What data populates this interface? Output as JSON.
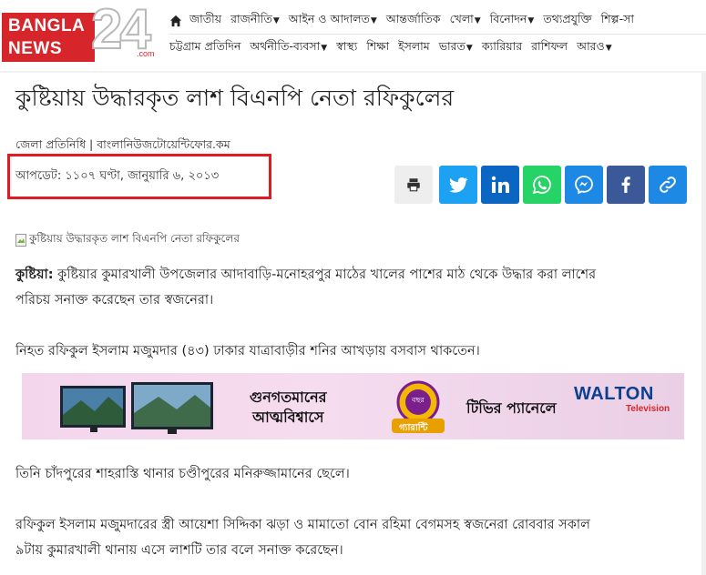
{
  "logo": {
    "line1": "BANGLA",
    "line2": "NEWS",
    "number": "24",
    "suffix": ".com"
  },
  "nav": {
    "row1": [
      {
        "label": "জাতীয়",
        "dropdown": false
      },
      {
        "label": "রাজনীতি",
        "dropdown": true
      },
      {
        "label": "আইন ও আদালত",
        "dropdown": true
      },
      {
        "label": "আন্তর্জাতিক",
        "dropdown": false
      },
      {
        "label": "খেলা",
        "dropdown": true
      },
      {
        "label": "বিনোদন",
        "dropdown": true
      },
      {
        "label": "তথ্যপ্রযুক্তি",
        "dropdown": false
      },
      {
        "label": "শিল্প-সা",
        "dropdown": false
      }
    ],
    "row2": [
      {
        "label": "চট্টগ্রাম প্রতিদিন",
        "dropdown": false
      },
      {
        "label": "অর্থনীতি-ব্যবসা",
        "dropdown": true
      },
      {
        "label": "স্বাস্থ্য",
        "dropdown": false
      },
      {
        "label": "শিক্ষা",
        "dropdown": false
      },
      {
        "label": "ইসলাম",
        "dropdown": false
      },
      {
        "label": "ভারত",
        "dropdown": true
      },
      {
        "label": "ক্যারিয়ার",
        "dropdown": false
      },
      {
        "label": "রাশিফল",
        "dropdown": false
      },
      {
        "label": "আরও",
        "dropdown": true
      }
    ]
  },
  "article": {
    "title": "কুষ্টিয়ায় উদ্ধারকৃত লাশ বিএনপি নেতা রফিকুলের",
    "byline": "জেলা প্রতিনিধি | বাংলানিউজটোয়েন্টিফোর.কম",
    "update": "আপডেট: ১১০৭ ঘণ্টা, জানুয়ারি ৬, ২০১৩",
    "image_alt": "কুষ্টিয়ায় উদ্ধারকৃত লাশ বিএনপি নেতা রফিকুলের",
    "dateline": "কুষ্টিয়া:",
    "p1_line1": " কুষ্টিয়ার কুমারখালী উপজেলার আদাবাড়ি-মনোহরপুর মাঠের খালের পাশের মাঠ থেকে উদ্ধার করা লাশের",
    "p1_line2": "পরিচয় সনাক্ত করেছেন তার স্বজনেরা।",
    "p2": "নিহত রফিকুল ইসলাম মজুমদার (৪৩) ঢাকার যাত্রাবাড়ীর শনির আখড়ায় বসবাস থাকতেন।",
    "p3": "তিনি চাঁদপুরের শাহরাস্তি থানার চণ্ডীপুরের মনিরুজ্জামানের ছেলে।",
    "p4_line1": "রফিকুল ইসলাম মজুমদারের স্ত্রী আয়েশা সিদ্দিকা ঝড়া ও মামাতো বোন রহিমা বেগমসহ স্বজনেরা রোববার সকাল",
    "p4_line2": "৯টায় কুমারখালী থানায় এসে লাশটি তার বলে সনাক্ত করেছেন।"
  },
  "share": [
    {
      "name": "print",
      "icon": "print-icon",
      "bg": "#eeeeee"
    },
    {
      "name": "twitter",
      "icon": "twitter-icon",
      "bg": "#1da1f2"
    },
    {
      "name": "linkedin",
      "icon": "linkedin-icon",
      "bg": "#0a66c2"
    },
    {
      "name": "whatsapp",
      "icon": "whatsapp-icon",
      "bg": "#25d366"
    },
    {
      "name": "messenger",
      "icon": "messenger-icon",
      "bg": "#1e88e5"
    },
    {
      "name": "facebook",
      "icon": "facebook-icon",
      "bg": "#3b5998"
    },
    {
      "name": "copy-link",
      "icon": "link-icon",
      "bg": "#1e88e5"
    }
  ],
  "ad": {
    "text1_line1": "গুনগতমানের",
    "text1_line2": "আত্মবিশ্বাসে",
    "badge_line1": "বছর",
    "badge_line2": "গ্যারান্টি",
    "text2": "টিভির প্যানেলে",
    "brand": "WALTON",
    "brand_sub": "Television"
  },
  "colors": {
    "brand_red": "#d7262b",
    "highlight_box": "#e01b22"
  }
}
